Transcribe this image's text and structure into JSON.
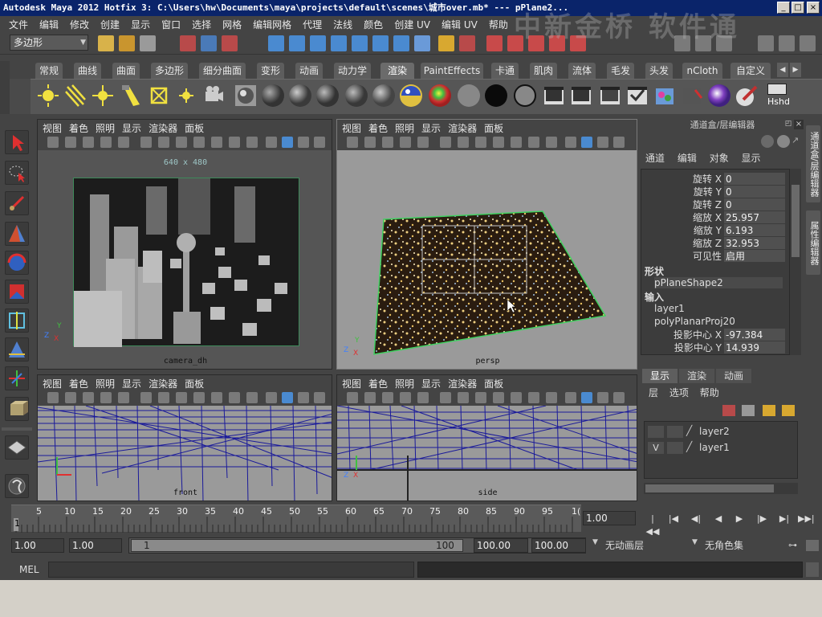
{
  "window": {
    "title": "Autodesk Maya 2012 Hotfix 3: C:\\Users\\hw\\Documents\\maya\\projects\\default\\scenes\\城市over.mb*   ---   pPlane2...",
    "watermark": "中新金桥 软件通",
    "btn_minimize": "_",
    "btn_maximize": "□",
    "btn_close": "×"
  },
  "menubar": {
    "items": [
      "文件",
      "编辑",
      "修改",
      "创建",
      "显示",
      "窗口",
      "选择",
      "网格",
      "编辑网格",
      "代理",
      "法线",
      "颜色",
      "创建 UV",
      "编辑 UV",
      "帮助"
    ]
  },
  "statusline": {
    "mode_value": "多边形"
  },
  "shelf": {
    "tabs": [
      "常规",
      "曲线",
      "曲面",
      "多边形",
      "细分曲面",
      "变形",
      "动画",
      "动力学",
      "渲染",
      "PaintEffects",
      "卡通",
      "肌肉",
      "流体",
      "毛发",
      "头发",
      "nCloth",
      "自定义"
    ],
    "active_tab": "渲染",
    "last_icon_label": "Hshd"
  },
  "viewports": {
    "menu": [
      "视图",
      "着色",
      "照明",
      "显示",
      "渲染器",
      "面板"
    ],
    "camera_label": "camera_dh",
    "resolution_label": "640 x 480",
    "persp_label": "persp",
    "front_label": "front",
    "side_label": "side"
  },
  "axis": {
    "x": "X",
    "y": "Y",
    "z": "Z"
  },
  "channel_box": {
    "title": "通道盒/层编辑器",
    "menu": [
      "通道",
      "编辑",
      "对象",
      "显示"
    ],
    "attributes": [
      {
        "label": "旋转 X",
        "value": "0"
      },
      {
        "label": "旋转 Y",
        "value": "0"
      },
      {
        "label": "旋转 Z",
        "value": "0"
      },
      {
        "label": "缩放 X",
        "value": "25.957"
      },
      {
        "label": "缩放 Y",
        "value": "6.193"
      },
      {
        "label": "缩放 Z",
        "value": "32.953"
      },
      {
        "label": "可见性",
        "value": "启用"
      }
    ],
    "shapes_header": "形状",
    "shape_name": "pPlaneShape2",
    "inputs_header": "输入",
    "inputs": [
      "layer1",
      "polyPlanarProj20"
    ],
    "proj_attributes": [
      {
        "label": "投影中心 X",
        "value": "-97.384"
      },
      {
        "label": "投影中心 Y",
        "value": "14.939"
      }
    ]
  },
  "side_tabs": [
    "通道盒/层编辑器",
    "属性编辑器"
  ],
  "layer_editor": {
    "tabs": [
      "显示",
      "渲染",
      "动画"
    ],
    "active_tab": "显示",
    "menu": [
      "层",
      "选项",
      "帮助"
    ],
    "layers": [
      {
        "visible": "",
        "name": "layer2"
      },
      {
        "visible": "V",
        "name": "layer1"
      }
    ]
  },
  "timeline": {
    "ticks": [
      "5",
      "10",
      "15",
      "20",
      "25",
      "30",
      "35",
      "40",
      "45",
      "50",
      "55",
      "60",
      "65",
      "70",
      "75",
      "80",
      "85",
      "90",
      "95",
      "1("
    ],
    "start_tick": "1",
    "current_time": "1.00",
    "playback": [
      "|◀◀",
      "|◀",
      "◀|",
      "◀",
      "▶",
      "|▶",
      "▶|",
      "▶▶|"
    ]
  },
  "range": {
    "start_time": "1.00",
    "playback_start": "1.00",
    "range_start": "1",
    "range_end": "100",
    "playback_end": "100.00",
    "end_time": "100.00",
    "anim_layer": "无动画层",
    "char_set": "无角色集"
  },
  "commandline": {
    "label": "MEL"
  }
}
